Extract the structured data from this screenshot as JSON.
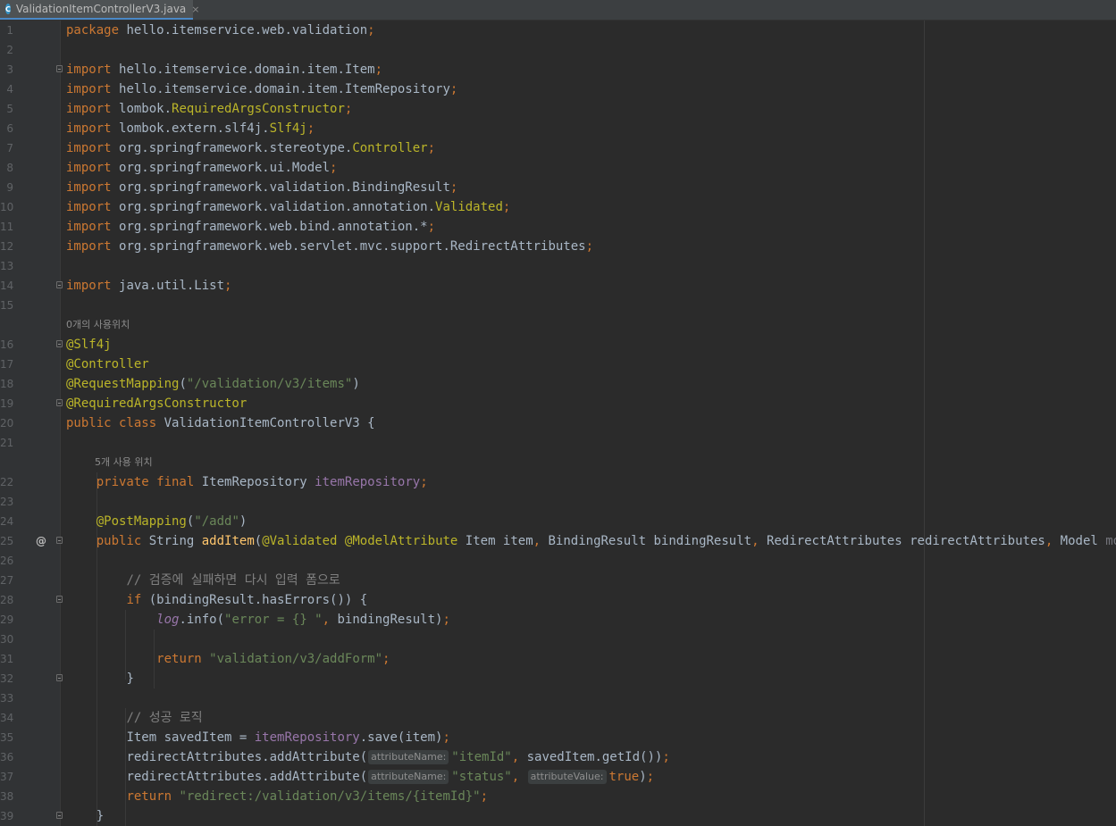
{
  "tab": {
    "icon_name": "class-c-icon",
    "icon_letter": "C",
    "file_name": "ValidationItemControllerV3.java",
    "close_glyph": "×"
  },
  "code_lines": [
    {
      "n": "1",
      "tokens": [
        {
          "t": "package ",
          "c": "kw"
        },
        {
          "t": "hello.itemservice.web.validation",
          "c": "def"
        },
        {
          "t": ";",
          "c": "kw"
        }
      ]
    },
    {
      "n": "2",
      "tokens": []
    },
    {
      "n": "3",
      "fold": true,
      "tokens": [
        {
          "t": "import ",
          "c": "kw"
        },
        {
          "t": "hello.itemservice.domain.item.Item",
          "c": "def"
        },
        {
          "t": ";",
          "c": "kw"
        }
      ]
    },
    {
      "n": "4",
      "tokens": [
        {
          "t": "import ",
          "c": "kw"
        },
        {
          "t": "hello.itemservice.domain.item.ItemRepository",
          "c": "def"
        },
        {
          "t": ";",
          "c": "kw"
        }
      ]
    },
    {
      "n": "5",
      "tokens": [
        {
          "t": "import ",
          "c": "kw"
        },
        {
          "t": "lombok.",
          "c": "def"
        },
        {
          "t": "RequiredArgsConstructor",
          "c": "ann"
        },
        {
          "t": ";",
          "c": "kw"
        }
      ]
    },
    {
      "n": "6",
      "tokens": [
        {
          "t": "import ",
          "c": "kw"
        },
        {
          "t": "lombok.extern.slf4j.",
          "c": "def"
        },
        {
          "t": "Slf4j",
          "c": "ann"
        },
        {
          "t": ";",
          "c": "kw"
        }
      ]
    },
    {
      "n": "7",
      "tokens": [
        {
          "t": "import ",
          "c": "kw"
        },
        {
          "t": "org.springframework.stereotype.",
          "c": "def"
        },
        {
          "t": "Controller",
          "c": "ann"
        },
        {
          "t": ";",
          "c": "kw"
        }
      ]
    },
    {
      "n": "8",
      "tokens": [
        {
          "t": "import ",
          "c": "kw"
        },
        {
          "t": "org.springframework.ui.Model",
          "c": "def"
        },
        {
          "t": ";",
          "c": "kw"
        }
      ]
    },
    {
      "n": "9",
      "tokens": [
        {
          "t": "import ",
          "c": "kw"
        },
        {
          "t": "org.springframework.validation.BindingResult",
          "c": "def"
        },
        {
          "t": ";",
          "c": "kw"
        }
      ]
    },
    {
      "n": "10",
      "tokens": [
        {
          "t": "import ",
          "c": "kw"
        },
        {
          "t": "org.springframework.validation.annotation.",
          "c": "def"
        },
        {
          "t": "Validated",
          "c": "ann"
        },
        {
          "t": ";",
          "c": "kw"
        }
      ]
    },
    {
      "n": "11",
      "tokens": [
        {
          "t": "import ",
          "c": "kw"
        },
        {
          "t": "org.springframework.web.bind.annotation.*",
          "c": "def"
        },
        {
          "t": ";",
          "c": "kw"
        }
      ]
    },
    {
      "n": "12",
      "tokens": [
        {
          "t": "import ",
          "c": "kw"
        },
        {
          "t": "org.springframework.web.servlet.mvc.support.RedirectAttributes",
          "c": "def"
        },
        {
          "t": ";",
          "c": "kw"
        }
      ]
    },
    {
      "n": "13",
      "tokens": []
    },
    {
      "n": "14",
      "fold": true,
      "tokens": [
        {
          "t": "import ",
          "c": "kw"
        },
        {
          "t": "java.util.List",
          "c": "def"
        },
        {
          "t": ";",
          "c": "kw"
        }
      ]
    },
    {
      "n": "15",
      "tokens": []
    },
    {
      "n": "",
      "hint": "0개의 사용위치",
      "indent": 0
    },
    {
      "n": "16",
      "fold": true,
      "tokens": [
        {
          "t": "@Slf4j",
          "c": "ann"
        }
      ]
    },
    {
      "n": "17",
      "tokens": [
        {
          "t": "@Controller",
          "c": "ann"
        }
      ]
    },
    {
      "n": "18",
      "tokens": [
        {
          "t": "@RequestMapping",
          "c": "ann"
        },
        {
          "t": "(",
          "c": "def"
        },
        {
          "t": "\"/validation/v3/items\"",
          "c": "str"
        },
        {
          "t": ")",
          "c": "def"
        }
      ]
    },
    {
      "n": "19",
      "fold": true,
      "tokens": [
        {
          "t": "@RequiredArgsConstructor",
          "c": "ann"
        }
      ]
    },
    {
      "n": "20",
      "tokens": [
        {
          "t": "public class ",
          "c": "kw"
        },
        {
          "t": "ValidationItemControllerV3 {",
          "c": "def"
        }
      ]
    },
    {
      "n": "21",
      "tokens": []
    },
    {
      "n": "",
      "hint": "5개 사용 위치",
      "indent": 4
    },
    {
      "n": "22",
      "tokens": [
        {
          "t": "    "
        },
        {
          "t": "private final ",
          "c": "kw"
        },
        {
          "t": "ItemRepository ",
          "c": "def"
        },
        {
          "t": "itemRepository",
          "c": "fld"
        },
        {
          "t": ";",
          "c": "kw"
        }
      ]
    },
    {
      "n": "23",
      "tokens": []
    },
    {
      "n": "24",
      "tokens": [
        {
          "t": "    "
        },
        {
          "t": "@PostMapping",
          "c": "ann"
        },
        {
          "t": "(",
          "c": "def"
        },
        {
          "t": "\"/add\"",
          "c": "str"
        },
        {
          "t": ")",
          "c": "def"
        }
      ]
    },
    {
      "n": "25",
      "at": true,
      "fold": true,
      "tokens": [
        {
          "t": "    "
        },
        {
          "t": "public ",
          "c": "kw"
        },
        {
          "t": "String ",
          "c": "def"
        },
        {
          "t": "addItem",
          "c": "fn"
        },
        {
          "t": "(",
          "c": "def"
        },
        {
          "t": "@Validated @ModelAttribute ",
          "c": "ann"
        },
        {
          "t": "Item item",
          "c": "def"
        },
        {
          "t": ", ",
          "c": "kw"
        },
        {
          "t": "BindingResult bindingResult",
          "c": "def"
        },
        {
          "t": ", ",
          "c": "kw"
        },
        {
          "t": "RedirectAttributes redirectAttributes",
          "c": "def"
        },
        {
          "t": ", ",
          "c": "kw"
        },
        {
          "t": "Model ",
          "c": "def"
        },
        {
          "t": "model",
          "c": "unused"
        },
        {
          "t": ") {",
          "c": "def"
        }
      ]
    },
    {
      "n": "26",
      "tokens": []
    },
    {
      "n": "27",
      "tokens": [
        {
          "t": "        "
        },
        {
          "t": "// 검증에 실패하면 다시 입력 폼으로",
          "c": "cmt"
        }
      ]
    },
    {
      "n": "28",
      "fold": true,
      "tokens": [
        {
          "t": "        "
        },
        {
          "t": "if ",
          "c": "kw"
        },
        {
          "t": "(bindingResult.hasErrors()) {",
          "c": "def"
        }
      ]
    },
    {
      "n": "29",
      "tokens": [
        {
          "t": "            "
        },
        {
          "t": "log",
          "c": "stat"
        },
        {
          "t": ".info(",
          "c": "def"
        },
        {
          "t": "\"error = {} \"",
          "c": "str"
        },
        {
          "t": ", ",
          "c": "kw"
        },
        {
          "t": "bindingResult)",
          "c": "def"
        },
        {
          "t": ";",
          "c": "kw"
        }
      ]
    },
    {
      "n": "30",
      "tokens": []
    },
    {
      "n": "31",
      "tokens": [
        {
          "t": "            "
        },
        {
          "t": "return ",
          "c": "kw"
        },
        {
          "t": "\"validation/v3/addForm\"",
          "c": "str"
        },
        {
          "t": ";",
          "c": "kw"
        }
      ]
    },
    {
      "n": "32",
      "fold": true,
      "tokens": [
        {
          "t": "        "
        },
        {
          "t": "}",
          "c": "def"
        }
      ]
    },
    {
      "n": "33",
      "tokens": []
    },
    {
      "n": "34",
      "tokens": [
        {
          "t": "        "
        },
        {
          "t": "// 성공 로직",
          "c": "cmt"
        }
      ]
    },
    {
      "n": "35",
      "tokens": [
        {
          "t": "        "
        },
        {
          "t": "Item savedItem = ",
          "c": "def"
        },
        {
          "t": "itemRepository",
          "c": "fld"
        },
        {
          "t": ".save(item)",
          "c": "def"
        },
        {
          "t": ";",
          "c": "kw"
        }
      ]
    },
    {
      "n": "36",
      "tokens": [
        {
          "t": "        "
        },
        {
          "t": "redirectAttributes.addAttribute(",
          "c": "def"
        },
        {
          "inlay": "attributeName:"
        },
        {
          "t": "\"itemId\"",
          "c": "str"
        },
        {
          "t": ", ",
          "c": "kw"
        },
        {
          "t": "savedItem.getId())",
          "c": "def"
        },
        {
          "t": ";",
          "c": "kw"
        }
      ]
    },
    {
      "n": "37",
      "tokens": [
        {
          "t": "        "
        },
        {
          "t": "redirectAttributes.addAttribute(",
          "c": "def"
        },
        {
          "inlay": "attributeName:"
        },
        {
          "t": "\"status\"",
          "c": "str"
        },
        {
          "t": ", ",
          "c": "kw"
        },
        {
          "inlay": "attributeValue:"
        },
        {
          "t": "true",
          "c": "kw"
        },
        {
          "t": ")",
          "c": "def"
        },
        {
          "t": ";",
          "c": "kw"
        }
      ]
    },
    {
      "n": "38",
      "tokens": [
        {
          "t": "        "
        },
        {
          "t": "return ",
          "c": "kw"
        },
        {
          "t": "\"redirect:/validation/v3/items/{itemId}\"",
          "c": "str"
        },
        {
          "t": ";",
          "c": "kw"
        }
      ]
    },
    {
      "n": "39",
      "fold": true,
      "tokens": [
        {
          "t": "    "
        },
        {
          "t": "}",
          "c": "def"
        }
      ]
    }
  ]
}
